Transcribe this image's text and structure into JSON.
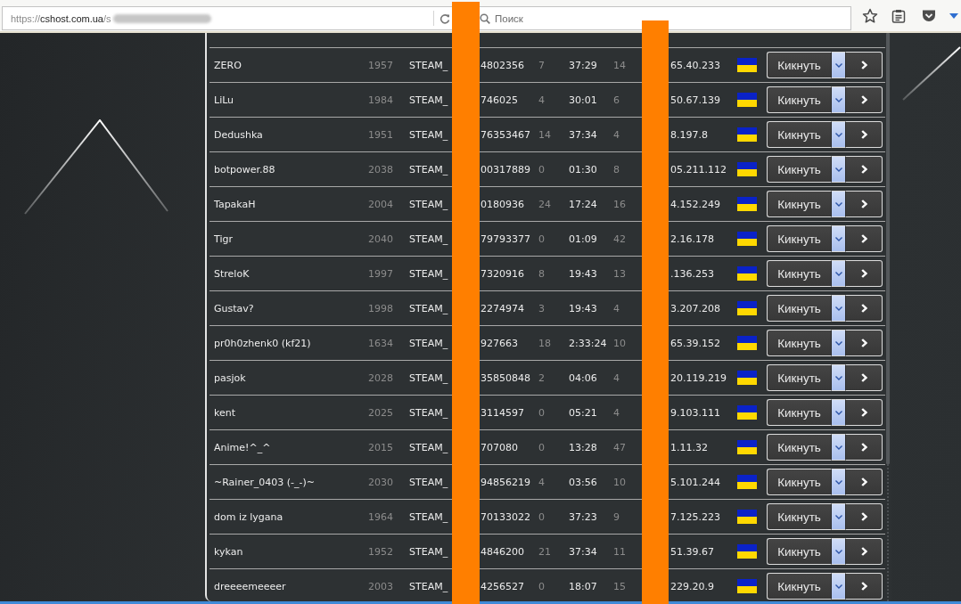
{
  "browser_toolbar": {
    "address_bar": {
      "scheme": "https://",
      "host": "cshost.com.ua",
      "path": "/s"
    },
    "search_bar": {
      "placeholder": "Поиск"
    }
  },
  "players": [
    {
      "name": "ZERO",
      "column_2": "1957",
      "steam_id_start": "STEAM_",
      "steam_id_end": "4802356",
      "column_4": "7",
      "time": "37:29",
      "column_6": "14",
      "ip_end": "65.40.233",
      "kick_label": "Кикнуть"
    },
    {
      "name": "LiLu",
      "column_2": "1984",
      "steam_id_start": "STEAM_",
      "steam_id_end": "746025",
      "column_4": "4",
      "time": "30:01",
      "column_6": "6",
      "ip_end": "50.67.139",
      "kick_label": "Кикнуть"
    },
    {
      "name": "Dedushka",
      "column_2": "1951",
      "steam_id_start": "STEAM_",
      "steam_id_end": "76353467",
      "column_4": "14",
      "time": "37:34",
      "column_6": "4",
      "ip_end": "8.197.8",
      "kick_label": "Кикнуть"
    },
    {
      "name": "botpower.88",
      "column_2": "2038",
      "steam_id_start": "STEAM_",
      "steam_id_end": "00317889",
      "column_4": "0",
      "time": "01:30",
      "column_6": "8",
      "ip_end": "05.211.112",
      "kick_label": "Кикнуть"
    },
    {
      "name": "TapakaH",
      "column_2": "2004",
      "steam_id_start": "STEAM_",
      "steam_id_end": "0180936",
      "column_4": "24",
      "time": "17:24",
      "column_6": "16",
      "ip_end": "4.152.249",
      "kick_label": "Кикнуть"
    },
    {
      "name": "Tigr",
      "column_2": "2040",
      "steam_id_start": "STEAM_",
      "steam_id_end": "79793377",
      "column_4": "0",
      "time": "01:09",
      "column_6": "42",
      "ip_end": "2.16.178",
      "kick_label": "Кикнуть"
    },
    {
      "name": "StreloK",
      "column_2": "1997",
      "steam_id_start": "STEAM_",
      "steam_id_end": "7320916",
      "column_4": "8",
      "time": "19:43",
      "column_6": "13",
      "ip_end": ".136.253",
      "kick_label": "Кикнуть"
    },
    {
      "name": "Gustav?",
      "column_2": "1998",
      "steam_id_start": "STEAM_",
      "steam_id_end": "2274974",
      "column_4": "3",
      "time": "19:43",
      "column_6": "4",
      "ip_end": "3.207.208",
      "kick_label": "Кикнуть"
    },
    {
      "name": "pr0h0zhenk0 (kf21)",
      "column_2": "1634",
      "steam_id_start": "STEAM_",
      "steam_id_end": "927663",
      "column_4": "18",
      "time": "2:33:24",
      "column_6": "10",
      "ip_end": "65.39.152",
      "kick_label": "Кикнуть"
    },
    {
      "name": "pasjok",
      "column_2": "2028",
      "steam_id_start": "STEAM_",
      "steam_id_end": "35850848",
      "column_4": "2",
      "time": "04:06",
      "column_6": "4",
      "ip_end": "20.119.219",
      "kick_label": "Кикнуть"
    },
    {
      "name": "kent",
      "column_2": "2025",
      "steam_id_start": "STEAM_",
      "steam_id_end": "3114597",
      "column_4": "0",
      "time": "05:21",
      "column_6": "4",
      "ip_end": "9.103.111",
      "kick_label": "Кикнуть"
    },
    {
      "name": "Anime!^_^",
      "column_2": "2015",
      "steam_id_start": "STEAM_",
      "steam_id_end": "707080",
      "column_4": "0",
      "time": "13:28",
      "column_6": "47",
      "ip_end": "1.11.32",
      "kick_label": "Кикнуть"
    },
    {
      "name": "~Rainer_0403 (-_-)~",
      "column_2": "2030",
      "steam_id_start": "STEAM_",
      "steam_id_end": "94856219",
      "column_4": "4",
      "time": "03:56",
      "column_6": "10",
      "ip_end": "5.101.244",
      "kick_label": "Кикнуть"
    },
    {
      "name": "dom iz lygana",
      "column_2": "1964",
      "steam_id_start": "STEAM_",
      "steam_id_end": "70133022",
      "column_4": "0",
      "time": "37:23",
      "column_6": "9",
      "ip_end": "7.125.223",
      "kick_label": "Кикнуть"
    },
    {
      "name": "kykan",
      "column_2": "1952",
      "steam_id_start": "STEAM_",
      "steam_id_end": "4846200",
      "column_4": "21",
      "time": "37:34",
      "column_6": "11",
      "ip_end": "51.39.67",
      "kick_label": "Кикнуть"
    },
    {
      "name": "dreeeemeeeer",
      "column_2": "2003",
      "steam_id_start": "STEAM_",
      "steam_id_end": "4256527",
      "column_4": "0",
      "time": "18:07",
      "column_6": "15",
      "ip_end": "229.20.9",
      "kick_label": "Кикнуть"
    }
  ]
}
